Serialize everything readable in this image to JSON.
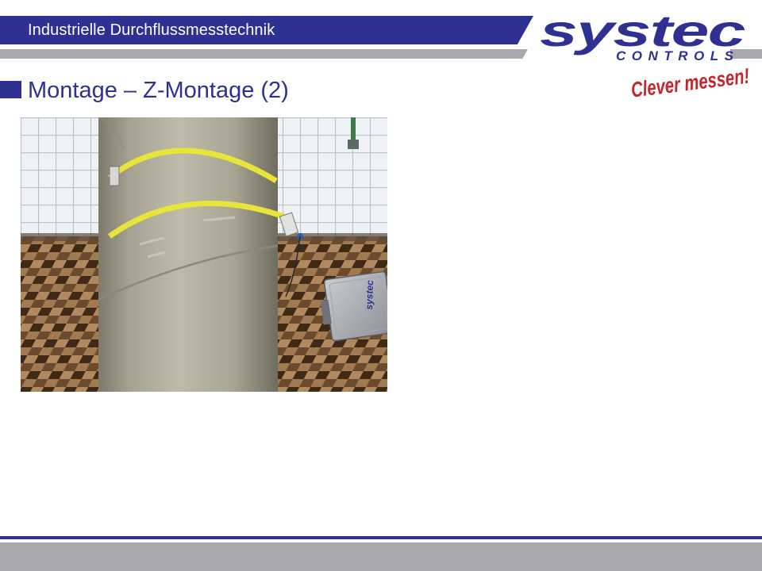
{
  "header": {
    "title": "Industrielle Durchflussmesstechnik"
  },
  "logo": {
    "brand": "systec",
    "subbrand": "CONTROLS",
    "slogan": "Clever messen!",
    "brand_color": "#2e3192",
    "slogan_color": "#c1272d"
  },
  "slide": {
    "title": "Montage – Z-Montage (2)"
  },
  "photo": {
    "case_label": "systec"
  },
  "colors": {
    "primary": "#2e3192",
    "gray": "#a7a9ac"
  }
}
